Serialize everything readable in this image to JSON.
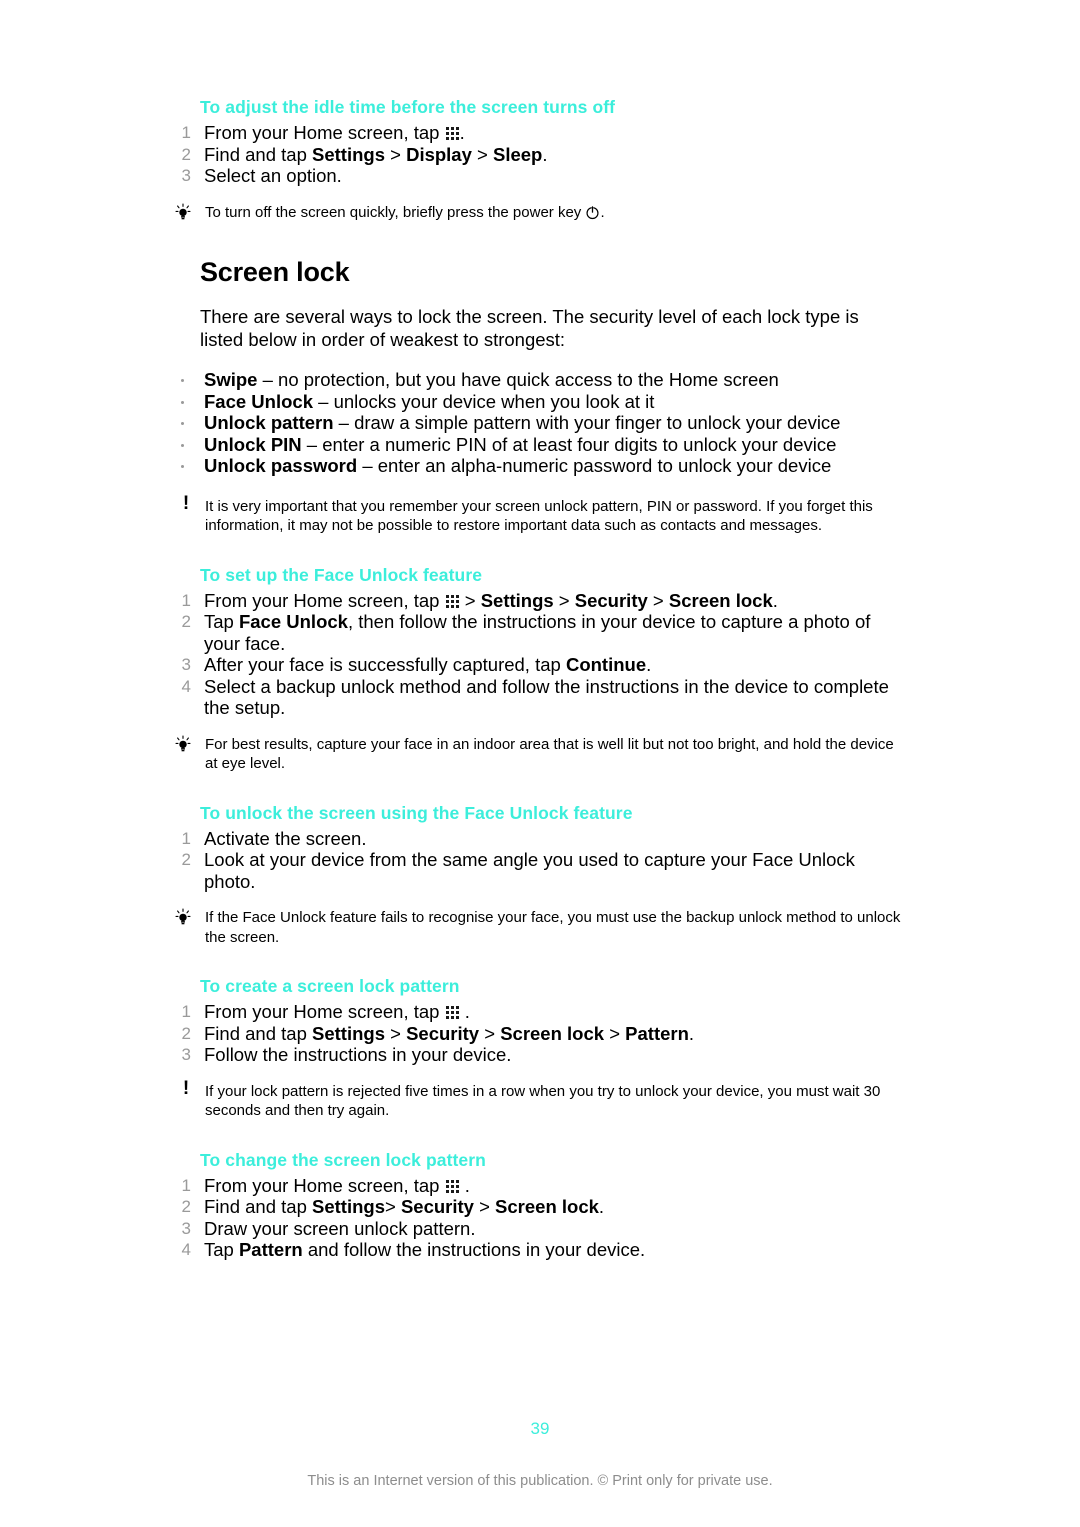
{
  "document": {
    "page_number": "39",
    "footer_note": "This is an Internet version of this publication. © Print only for private use.",
    "accent_color": "#3ceedb",
    "text_color": "#000000",
    "muted_color": "#9a9a9a"
  },
  "sections": {
    "idle_time": {
      "heading": "To adjust the idle time before the screen turns off",
      "steps": [
        {
          "num": "1",
          "pre": "From your Home screen, tap ",
          "icon": "app-grid-icon",
          "post": "."
        },
        {
          "num": "2",
          "pre": "Find and tap ",
          "b1": "Settings",
          "s1": " > ",
          "b2": "Display",
          "s2": " > ",
          "b3": "Sleep",
          "post": "."
        },
        {
          "num": "3",
          "pre": "Select an option."
        }
      ],
      "tip": {
        "icon": "lightbulb-icon",
        "pre": "To turn off the screen quickly, briefly press the power key ",
        "post": "."
      }
    },
    "screen_lock": {
      "title": "Screen lock",
      "intro": "There are several ways to lock the screen. The security level of each lock type is listed below in order of weakest to strongest:",
      "lock_types": [
        {
          "term": "Swipe",
          "desc": " – no protection, but you have quick access to the Home screen"
        },
        {
          "term": "Face Unlock",
          "desc": " – unlocks your device when you look at it"
        },
        {
          "term": "Unlock pattern",
          "desc": " – draw a simple pattern with your finger to unlock your device"
        },
        {
          "term": "Unlock PIN",
          "desc": " – enter a numeric PIN of at least four digits to unlock your device"
        },
        {
          "term": "Unlock password",
          "desc": " – enter an alpha-numeric password to unlock your device"
        }
      ],
      "warning": {
        "icon": "exclamation-icon",
        "text": "It is very important that you remember your screen unlock pattern, PIN or password. If you forget this information, it may not be possible to restore important data such as contacts and messages."
      }
    },
    "face_unlock_setup": {
      "heading": "To set up the Face Unlock feature",
      "steps": [
        {
          "num": "1",
          "pre": "From your Home screen, tap ",
          "icon": "app-grid-icon",
          "s0": " > ",
          "b1": "Settings",
          "s1": " > ",
          "b2": "Security",
          "s2": " > ",
          "b3": "Screen lock",
          "post": "."
        },
        {
          "num": "2",
          "pre": "Tap ",
          "b1": "Face Unlock",
          "post": ", then follow the instructions in your device to capture a photo of your face."
        },
        {
          "num": "3",
          "pre": "After your face is successfully captured, tap ",
          "b1": "Continue",
          "post": "."
        },
        {
          "num": "4",
          "pre": "Select a backup unlock method and follow the instructions in the device to complete the setup."
        }
      ],
      "tip": {
        "icon": "lightbulb-icon",
        "text": "For best results, capture your face in an indoor area that is well lit but not too bright, and hold the device at eye level."
      }
    },
    "face_unlock_use": {
      "heading": "To unlock the screen using the Face Unlock feature",
      "steps": [
        {
          "num": "1",
          "pre": "Activate the screen."
        },
        {
          "num": "2",
          "pre": "Look at your device from the same angle you used to capture your Face Unlock photo."
        }
      ],
      "tip": {
        "icon": "lightbulb-icon",
        "text": "If the Face Unlock feature fails to recognise your face, you must use the backup unlock method to unlock the screen."
      }
    },
    "create_pattern": {
      "heading": "To create a screen lock pattern",
      "steps": [
        {
          "num": "1",
          "pre": "From your Home screen, tap ",
          "icon": "app-grid-icon",
          "post": " ."
        },
        {
          "num": "2",
          "pre": "Find and tap ",
          "b1": "Settings",
          "s1": " > ",
          "b2": "Security",
          "s2": " > ",
          "b3": "Screen lock",
          "s3": " > ",
          "b4": "Pattern",
          "post": "."
        },
        {
          "num": "3",
          "pre": "Follow the instructions in your device."
        }
      ],
      "warning": {
        "icon": "exclamation-icon",
        "text": "If your lock pattern is rejected five times in a row when you try to unlock your device, you must wait 30 seconds and then try again."
      }
    },
    "change_pattern": {
      "heading": "To change the screen lock pattern",
      "steps": [
        {
          "num": "1",
          "pre": "From your Home screen, tap ",
          "icon": "app-grid-icon",
          "post": " ."
        },
        {
          "num": "2",
          "pre": "Find and tap ",
          "b1": "Settings",
          "s1": "> ",
          "b2": "Security",
          "s2": " > ",
          "b3": "Screen lock",
          "post": "."
        },
        {
          "num": "3",
          "pre": "Draw your screen unlock pattern."
        },
        {
          "num": "4",
          "pre": "Tap ",
          "b1": "Pattern",
          "post": " and follow the instructions in your device."
        }
      ]
    }
  }
}
